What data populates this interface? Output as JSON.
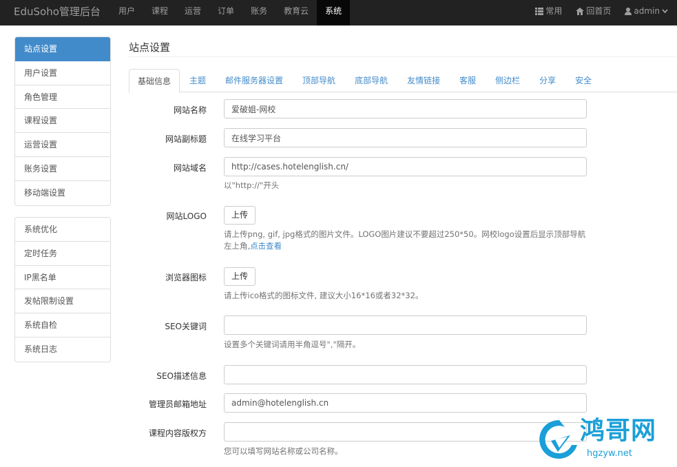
{
  "navbar": {
    "brand": "EduSoho管理后台",
    "menu": [
      "用户",
      "课程",
      "运营",
      "订单",
      "账务",
      "教育云",
      "系统"
    ],
    "right": {
      "common": "常用",
      "home": "回首页",
      "user": "admin"
    }
  },
  "sidebar": {
    "group1": [
      "站点设置",
      "用户设置",
      "角色管理",
      "课程设置",
      "运营设置",
      "账务设置",
      "移动端设置"
    ],
    "group2": [
      "系统优化",
      "定时任务",
      "IP黑名单",
      "发帖限制设置",
      "系统自检",
      "系统日志"
    ]
  },
  "main": {
    "title": "站点设置",
    "tabs": [
      "基础信息",
      "主题",
      "邮件服务器设置",
      "顶部导航",
      "底部导航",
      "友情链接",
      "客服",
      "侧边栏",
      "分享",
      "安全"
    ],
    "form": {
      "site_name": {
        "label": "网站名称",
        "value": "爱破姐-网校"
      },
      "site_slogan": {
        "label": "网站副标题",
        "value": "在线学习平台"
      },
      "site_url": {
        "label": "网站域名",
        "value": "http://cases.hotelenglish.cn/",
        "help": "以\"http://\"开头"
      },
      "logo": {
        "label": "网站LOGO",
        "button": "上传",
        "help": "请上传png, gif, jpg格式的图片文件。LOGO图片建议不要超过250*50。网校logo设置后显示顶部导航",
        "help2": "左上角,",
        "help_link": "点击查看"
      },
      "favicon": {
        "label": "浏览器图标",
        "button": "上传",
        "help": "请上传ico格式的图标文件, 建议大小16*16或者32*32。"
      },
      "seo_keywords": {
        "label": "SEO关键词",
        "value": "",
        "help": "设置多个关键词请用半角逗号\",\"隔开。"
      },
      "seo_description": {
        "label": "SEO描述信息",
        "value": ""
      },
      "master_email": {
        "label": "管理员邮箱地址",
        "value": "admin@hotelenglish.cn"
      },
      "copyright": {
        "label": "课程内容版权方",
        "value": "",
        "help": "您可以填写网站名称或公司名称。"
      }
    }
  },
  "watermark": {
    "title": "鸿哥网",
    "sub": "hgzyw.net"
  },
  "colors": {
    "accent": "#428bca",
    "navbar": "#222222",
    "watermark": "#1a9fd8"
  }
}
